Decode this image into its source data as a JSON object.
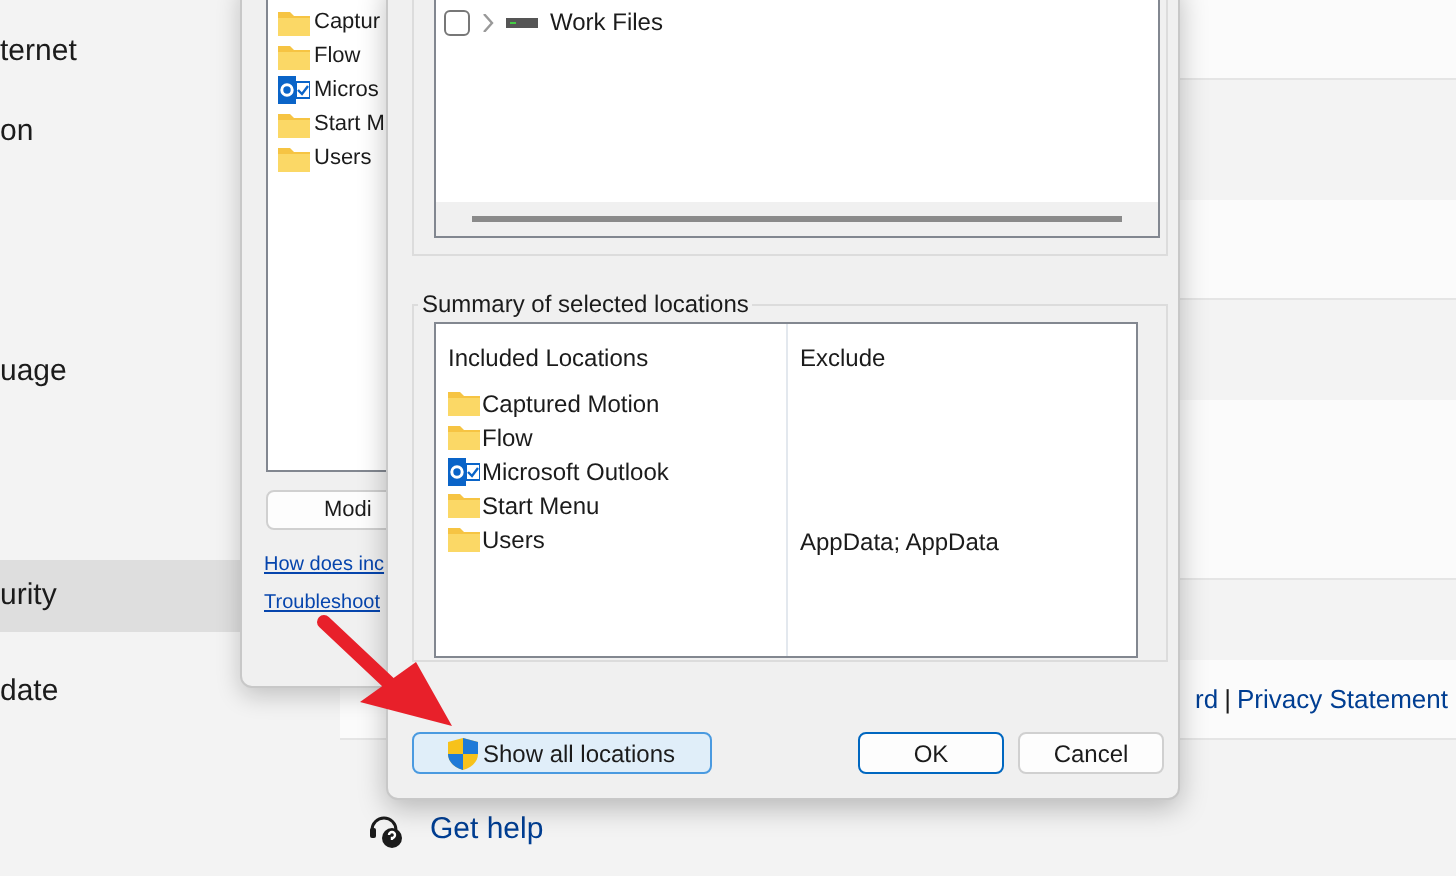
{
  "settings": {
    "nav_items": [
      {
        "label": "ternet",
        "selected": false
      },
      {
        "label": "on",
        "selected": false
      },
      {
        "label": "uage",
        "selected": false
      },
      {
        "label": "urity",
        "selected": true
      },
      {
        "label": "date",
        "selected": false
      }
    ],
    "footer_links": [
      "rd",
      "Privacy Statement"
    ],
    "footer_separator": "|",
    "help_link": "Get help"
  },
  "indexing_dialog": {
    "locations": [
      {
        "label": "Captur",
        "kind": "folder"
      },
      {
        "label": "Flow",
        "kind": "folder"
      },
      {
        "label": "Micros",
        "kind": "outlook"
      },
      {
        "label": "Start M",
        "kind": "folder"
      },
      {
        "label": "Users",
        "kind": "folder"
      }
    ],
    "modify_button": "Modi",
    "links": [
      "How does inc",
      "Troubleshoot"
    ]
  },
  "locations_dialog": {
    "tree_items": [
      {
        "label": "Work Files",
        "checked": false,
        "expanded": false
      }
    ],
    "summary": {
      "title": "Summary of selected locations",
      "columns": [
        "Included Locations",
        "Exclude"
      ],
      "rows": [
        {
          "location": "Captured Motion",
          "kind": "folder"
        },
        {
          "location": "Flow",
          "kind": "folder"
        },
        {
          "location": "Microsoft Outlook",
          "kind": "outlook"
        },
        {
          "location": "Start Menu",
          "kind": "folder"
        },
        {
          "location": "Users",
          "kind": "folder",
          "exclude": "AppData; AppData"
        }
      ]
    },
    "buttons": [
      {
        "label": "Show all locations",
        "kind": "shield",
        "default": false
      },
      {
        "label": "OK",
        "kind": "plain",
        "default": true
      },
      {
        "label": "Cancel",
        "kind": "plain",
        "default": false
      }
    ]
  }
}
